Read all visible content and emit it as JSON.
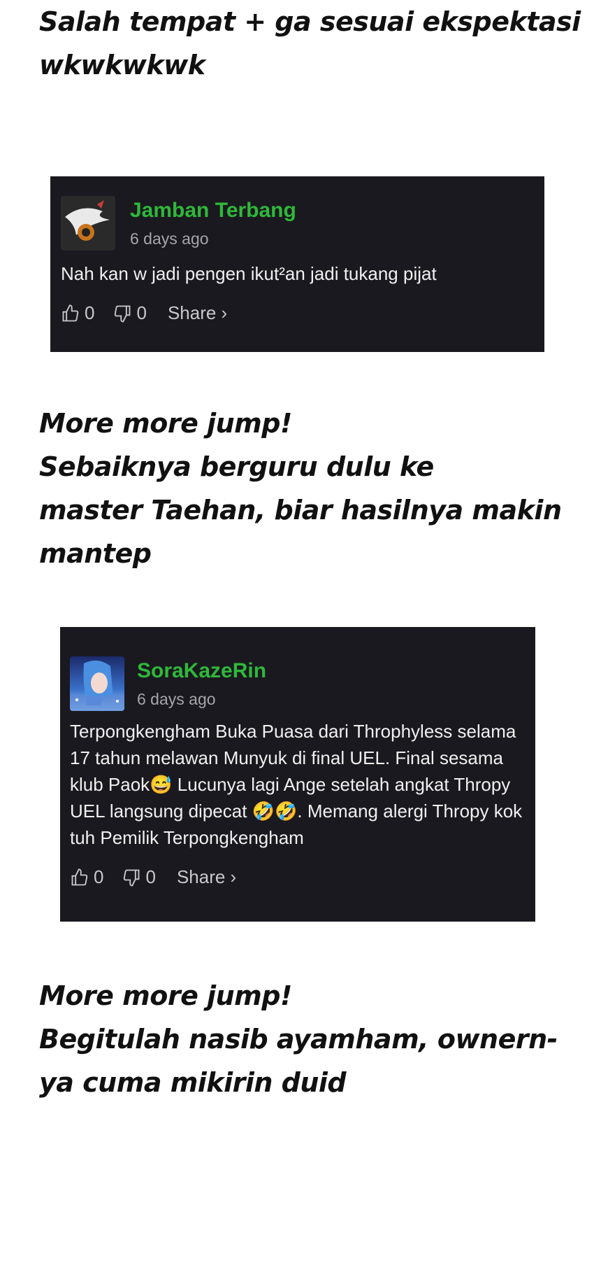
{
  "captions": [
    "Salah tempat + ga sesuai ekspektasi\nwkwkwkwk",
    "More more jump!\nSebaiknya berguru dulu ke\nmaster Taehan, biar hasilnya makin\nmantep",
    "More more jump!\nBegitulah nasib ayamham, ownern-\nya cuma mikirin duid"
  ],
  "comments": [
    {
      "username": "Jamban Terbang",
      "time": "6 days ago",
      "text": "Nah kan w jadi pengen ikut²an jadi tukang pijat",
      "likes": "0",
      "dislikes": "0",
      "share_label": "Share ›"
    },
    {
      "username": "SoraKazeRin",
      "time": "6 days ago",
      "text": "Terpongkengham Buka Puasa dari Throphyless selama 17 tahun melawan Munyuk di final UEL. Final sesama klub Paok😅 Lucunya lagi Ange setelah angkat Thropy UEL langsung dipecat 🤣🤣. Memang alergi Thropy kok tuh Pemilik Terpongkengham",
      "likes": "0",
      "dislikes": "0",
      "share_label": "Share ›"
    }
  ],
  "colors": {
    "username": "#2fb83a",
    "card_bg": "#1a191f",
    "meta": "#a5a5aa"
  },
  "icons": [
    "thumbs-up-icon",
    "thumbs-down-icon"
  ]
}
